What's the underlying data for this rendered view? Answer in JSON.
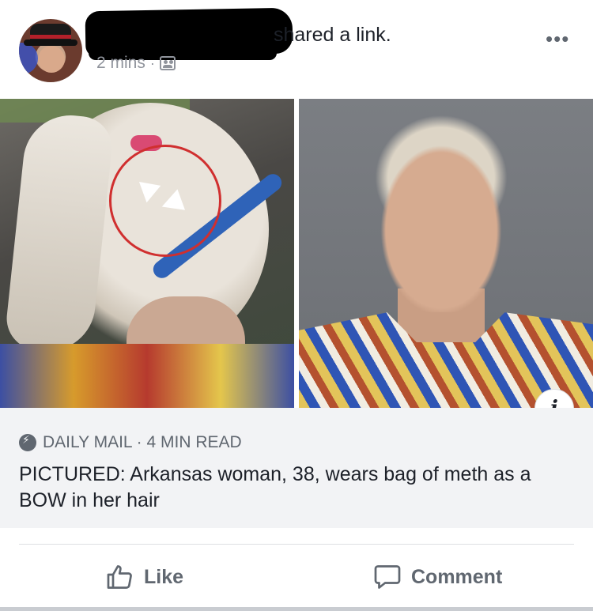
{
  "post": {
    "shared_text": "shared a link.",
    "time": "2 mins",
    "separator": "·"
  },
  "link": {
    "source": "DAILY MAIL · 4 MIN READ",
    "headline": "PICTURED: Arkansas woman, 38, wears bag of meth as a BOW in her hair"
  },
  "actions": {
    "like_label": "Like",
    "comment_label": "Comment"
  },
  "icons": {
    "more": "more-options-icon",
    "audience": "group-audience-icon",
    "info": "info-icon",
    "source": "instant-article-bolt-icon",
    "like": "thumbs-up-icon",
    "comment": "comment-bubble-icon"
  },
  "colors": {
    "text": "#1d2129",
    "secondary": "#606770",
    "meta": "#90949c",
    "preview_bg": "#f2f3f5",
    "annotation_circle": "#d02f2f"
  }
}
